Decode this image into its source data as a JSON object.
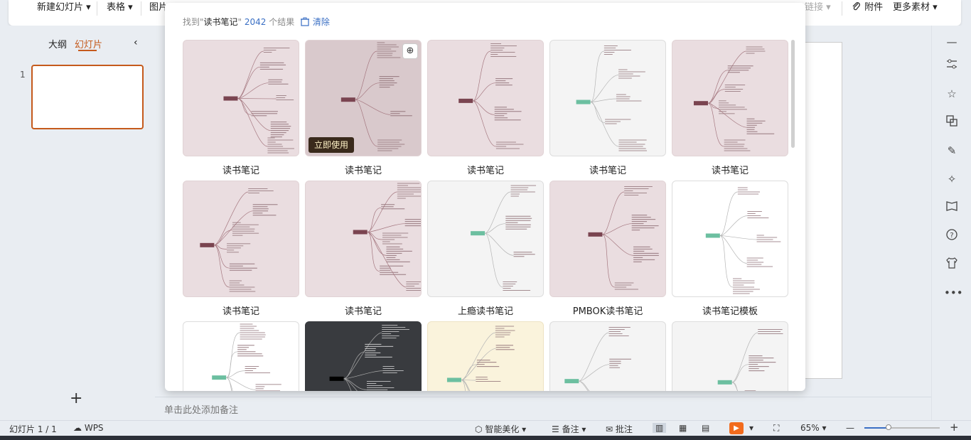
{
  "toolbar": {
    "new_slide": "新建幻灯片",
    "table": "表格",
    "picture": "图片",
    "link": "链接",
    "attachment": "附件",
    "more_material": "更多素材"
  },
  "left_panel": {
    "tab_outline": "大纲",
    "tab_slides": "幻灯片",
    "slide_number": "1",
    "add_symbol": "+"
  },
  "notes": {
    "placeholder": "单击此处添加备注"
  },
  "status": {
    "slide_info": "幻灯片 1 / 1",
    "wps": "WPS",
    "beautify": "智能美化",
    "notes": "备注",
    "comment": "批注",
    "zoom": "65%"
  },
  "popup": {
    "prefix": "找到\"",
    "query": "读书笔记",
    "suffix": "\"",
    "count": "2042",
    "result_word": "个结果",
    "clear": "清除",
    "use_now": "立即使用",
    "cards": [
      {
        "label": "读书笔记",
        "style": "pink"
      },
      {
        "label": "读书笔记",
        "style": "pink"
      },
      {
        "label": "读书笔记",
        "style": "pink"
      },
      {
        "label": "读书笔记",
        "style": "gray"
      },
      {
        "label": "读书笔记",
        "style": "pink"
      },
      {
        "label": "读书笔记",
        "style": "pink"
      },
      {
        "label": "读书笔记",
        "style": "pink"
      },
      {
        "label": "上瘾读书笔记",
        "style": "gray"
      },
      {
        "label": "PMBOK读书笔记",
        "style": "pink"
      },
      {
        "label": "读书笔记模板",
        "style": "white"
      },
      {
        "label": "",
        "style": "white"
      },
      {
        "label": "",
        "style": "dark"
      },
      {
        "label": "",
        "style": "cream"
      },
      {
        "label": "",
        "style": "gray"
      },
      {
        "label": "",
        "style": "gray"
      }
    ]
  },
  "colors": {
    "accent": "#c55a1c",
    "link": "#3a6fc4",
    "card_pink": "#eadde0",
    "use_button_bg": "#3a2a1c"
  }
}
